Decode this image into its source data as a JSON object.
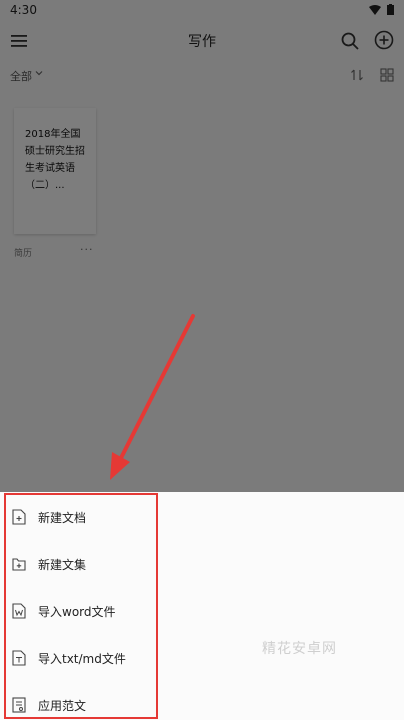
{
  "status_bar": {
    "time": "4:30"
  },
  "header": {
    "title": "写作"
  },
  "filter": {
    "label": "全部"
  },
  "documents": [
    {
      "title": "2018年全国硕士研究生招生考试英语（二）...",
      "meta": "简历"
    }
  ],
  "menu": {
    "items": [
      {
        "label": "新建文档",
        "icon": "document-add-icon"
      },
      {
        "label": "新建文集",
        "icon": "folder-add-icon"
      },
      {
        "label": "导入word文件",
        "icon": "word-file-icon"
      },
      {
        "label": "导入txt/md文件",
        "icon": "text-file-icon"
      },
      {
        "label": "应用范文",
        "icon": "template-icon"
      }
    ]
  },
  "watermark": "精花安卓网",
  "colors": {
    "highlight": "#e53935",
    "overlay": "rgba(0,0,0,0.5)"
  }
}
